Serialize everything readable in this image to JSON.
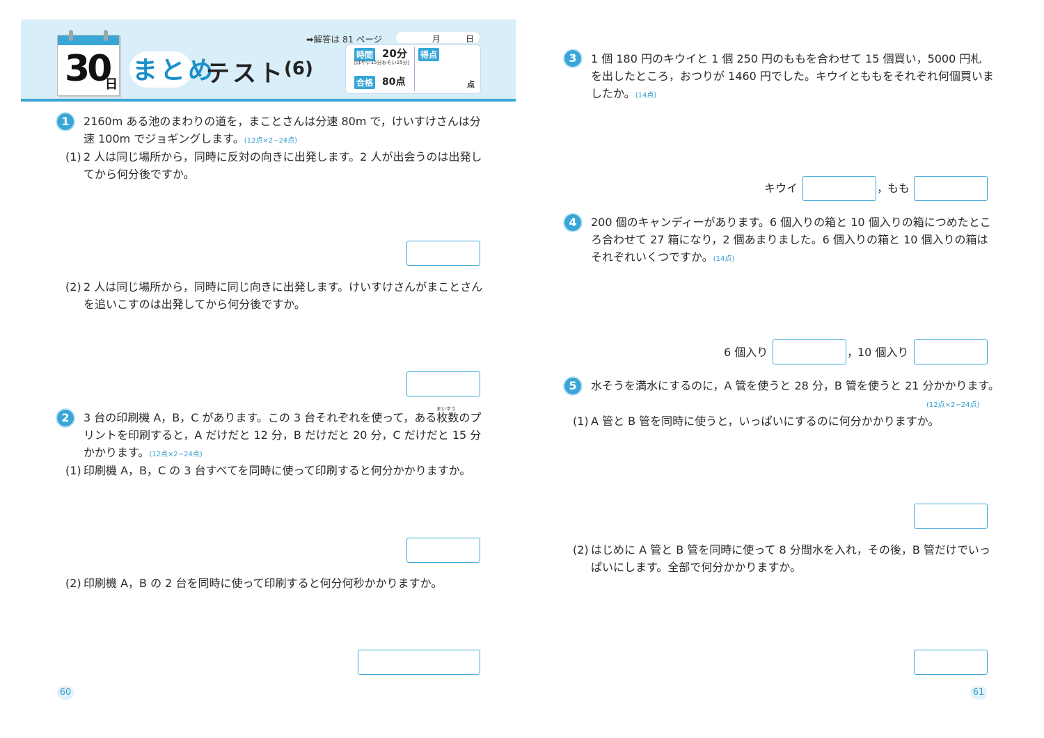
{
  "header": {
    "day_number": "30",
    "day_suffix": "日",
    "title_highlight": "まとめ",
    "title_rest": "テスト",
    "title_number": "(6)",
    "answer_ref": "➡解答は 81 ページ",
    "date_month": "月",
    "date_day": "日",
    "time_label": "時間",
    "time_value": "20分",
    "time_note": "[はやい15分おそい25分]",
    "score_label": "得点",
    "pass_label": "合格",
    "pass_value": "80点",
    "score_unit": "点"
  },
  "left_page": {
    "q1": {
      "number": "1",
      "line1": "2160m ある池のまわりの道を，まことさんは分速 80m で，けいすけさんは分",
      "line2": "速 100m でジョギングします。",
      "points": "(12点×2−24点)",
      "sub1_label": "(1)",
      "sub1_line1": "2 人は同じ場所から，同時に反対の向きに出発します。2 人が出会うのは出発し",
      "sub1_line2": "てから何分後ですか。",
      "sub2_label": "(2)",
      "sub2_line1": "2 人は同じ場所から，同時に同じ向きに出発します。けいすけさんがまことさん",
      "sub2_line2": "を追いこすのは出発してから何分後ですか。"
    },
    "q2": {
      "number": "2",
      "ruby": "まいすう",
      "line1": "3 台の印刷機 A，B，C があります。この 3 台それぞれを使って，ある枚数のプ",
      "line2": "リントを印刷すると，A だけだと 12 分，B だけだと 20 分，C だけだと 15 分",
      "line3": "かかります。",
      "points": "(12点×2−24点)",
      "sub1_label": "(1)",
      "sub1_line1": "印刷機 A，B，C の 3 台すべてを同時に使って印刷すると何分かかりますか。",
      "sub2_label": "(2)",
      "sub2_line1": "印刷機 A，B の 2 台を同時に使って印刷すると何分何秒かかりますか。"
    },
    "page_number": "60"
  },
  "right_page": {
    "q3": {
      "number": "3",
      "line1": "1 個 180 円のキウイと 1 個 250 円のももを合わせて 15 個買い，5000 円札",
      "line2": "を出したところ，おつりが 1460 円でした。キウイとももをそれぞれ何個買いま",
      "line3": "したか。",
      "points": "(14点)",
      "label_a": "キウイ",
      "sep": "，",
      "label_b": "もも"
    },
    "q4": {
      "number": "4",
      "line1": "200 個のキャンディーがあります。6 個入りの箱と 10 個入りの箱につめたとこ",
      "line2": "ろ合わせて 27 箱になり，2 個あまりました。6 個入りの箱と 10 個入りの箱は",
      "line3": "それぞれいくつですか。",
      "points": "(14点)",
      "label_a": "6 個入り",
      "sep": "，",
      "label_b": "10 個入り"
    },
    "q5": {
      "number": "5",
      "line1": "水そうを満水にするのに，A 管を使うと 28 分，B 管を使うと 21 分かかります。",
      "points": "(12点×2−24点)",
      "sub1_label": "(1)",
      "sub1_line1": "A 管と B 管を同時に使うと，いっぱいにするのに何分かかりますか。",
      "sub2_label": "(2)",
      "sub2_line1": "はじめに A 管と B 管を同時に使って 8 分間水を入れ，その後，B 管だけでいっ",
      "sub2_line2": "ぱいにします。全部で何分かかりますか。"
    },
    "page_number": "61"
  },
  "colors": {
    "accent": "#3aa6d8",
    "header_bg": "#d8eef8",
    "text": "#2a2a2a"
  }
}
